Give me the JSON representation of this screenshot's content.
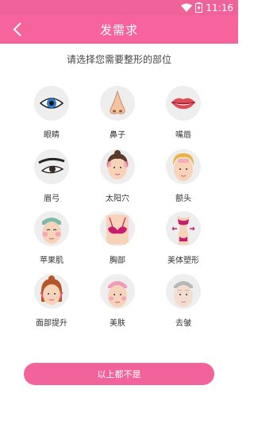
{
  "status_bar": {
    "time": "11:16"
  },
  "header": {
    "title": "发需求"
  },
  "prompt": "请选择您需要整形的部位",
  "parts": [
    {
      "label": "眼睛",
      "icon": "eye-icon"
    },
    {
      "label": "鼻子",
      "icon": "nose-icon"
    },
    {
      "label": "嘴唇",
      "icon": "lips-icon"
    },
    {
      "label": "眉弓",
      "icon": "eyebrow-icon"
    },
    {
      "label": "太阳穴",
      "icon": "temple-icon"
    },
    {
      "label": "额头",
      "icon": "forehead-icon"
    },
    {
      "label": "苹果肌",
      "icon": "cheek-icon"
    },
    {
      "label": "胸部",
      "icon": "chest-icon"
    },
    {
      "label": "美体塑形",
      "icon": "body-shaping-icon"
    },
    {
      "label": "面部提升",
      "icon": "face-lift-icon"
    },
    {
      "label": "美肤",
      "icon": "skin-care-icon"
    },
    {
      "label": "去皱",
      "icon": "wrinkle-removal-icon"
    }
  ],
  "none_button": "以上都不是",
  "colors": {
    "brand": "#f7639c",
    "status_bar": "#f0639a",
    "circle_bg": "#eeeeee"
  }
}
